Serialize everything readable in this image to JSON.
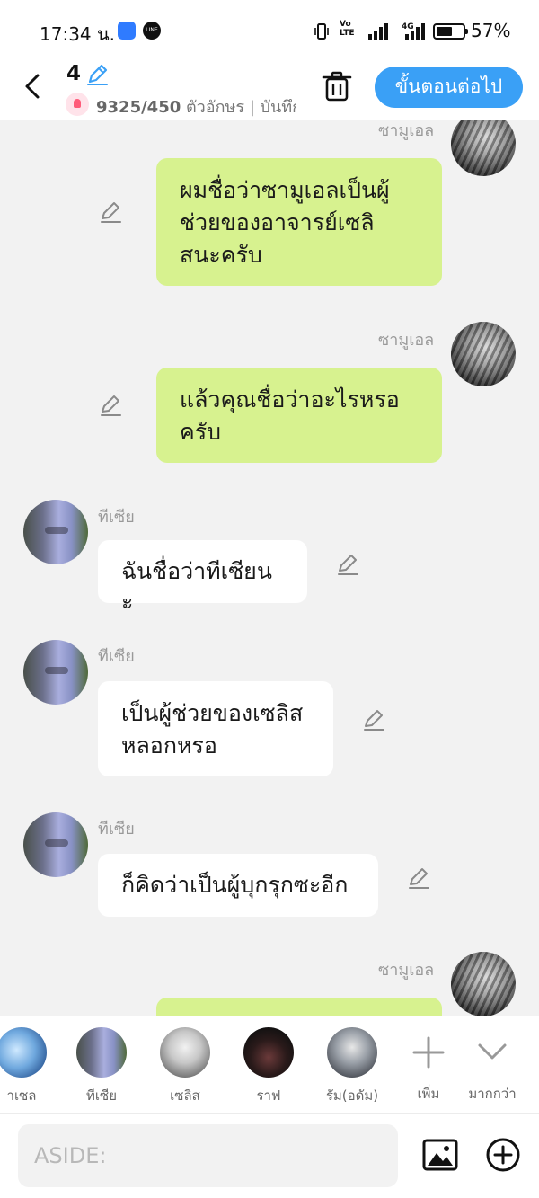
{
  "status_bar": {
    "time": "17:34 น.",
    "app_icons": [
      "notes-app-icon",
      "line-app-icon"
    ],
    "line_label": "LINE",
    "volte_top": "Vo",
    "volte_bottom": "LTE",
    "network": "4G",
    "battery": "57%",
    "battery_level": 0.57
  },
  "header": {
    "title": "4",
    "char_count": "9325/450",
    "count_suffix": " ตัวอักษร | บันทึก",
    "next_label": "ขั้นตอนต่อไป"
  },
  "messages": [
    {
      "sender": "ซามูเอล",
      "side": "right",
      "text": "ผมชื่อว่าซามูเอลเป็นผู้\nช่วยของอาจารย์เซลิ\nสนะครับ"
    },
    {
      "sender": "ซามูเอล",
      "side": "right",
      "text": "แล้วคุณชื่อว่าอะไรหรอ\nครับ"
    },
    {
      "sender": "ทีเซีย",
      "side": "left",
      "text": "ฉันชื่อว่าทีเซียนะ"
    },
    {
      "sender": "ทีเซีย",
      "side": "left",
      "text": "เป็นผู้ช่วยของเซลิส\nหลอกหรอ"
    },
    {
      "sender": "ทีเซีย",
      "side": "left",
      "text": "ก็คิดว่าเป็นผู้บุกรุกซะอีก"
    },
    {
      "sender": "ซามูเอล",
      "side": "right",
      "text": ""
    }
  ],
  "characters": [
    {
      "label": "ซามูเอล",
      "label_visible": "าเซล"
    },
    {
      "label": "ทีเซีย"
    },
    {
      "label": "เซลิส"
    },
    {
      "label": "ราฟ"
    },
    {
      "label": "รัม(อดัม)"
    }
  ],
  "char_actions": {
    "add_label": "เพิ่ม",
    "more_label": "มากกว่า"
  },
  "input": {
    "placeholder": "ASIDE:"
  },
  "colors": {
    "accent": "#3aa0f6",
    "my_bubble": "#d7f28f",
    "their_bubble": "#ffffff",
    "background": "#f2f2f2"
  }
}
